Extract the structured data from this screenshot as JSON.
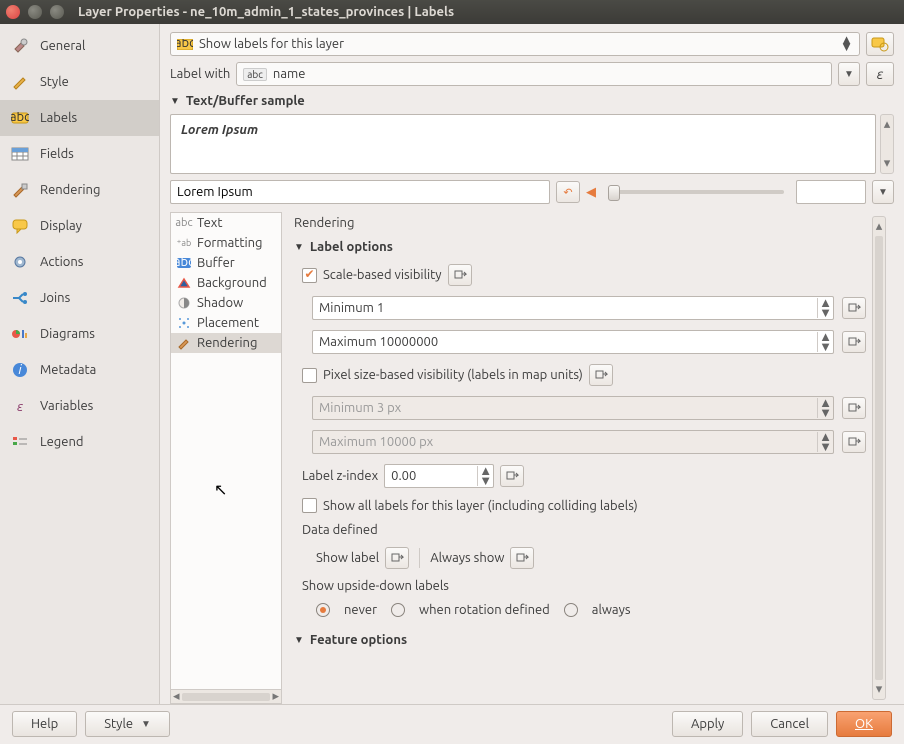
{
  "window": {
    "title": "Layer Properties - ne_10m_admin_1_states_provinces | Labels"
  },
  "sidebar": {
    "items": [
      {
        "label": "General"
      },
      {
        "label": "Style"
      },
      {
        "label": "Labels"
      },
      {
        "label": "Fields"
      },
      {
        "label": "Rendering"
      },
      {
        "label": "Display"
      },
      {
        "label": "Actions"
      },
      {
        "label": "Joins"
      },
      {
        "label": "Diagrams"
      },
      {
        "label": "Metadata"
      },
      {
        "label": "Variables"
      },
      {
        "label": "Legend"
      }
    ],
    "active_index": 2
  },
  "top": {
    "mode": "Show labels for this layer",
    "label_with_text": "Label with",
    "label_with_value": "name",
    "epsilon": "ε"
  },
  "sample": {
    "header": "Text/Buffer sample",
    "preview_text": "Lorem Ipsum",
    "input_value": "Lorem Ipsum"
  },
  "sublist": {
    "items": [
      {
        "label": "Text"
      },
      {
        "label": "Formatting"
      },
      {
        "label": "Buffer"
      },
      {
        "label": "Background"
      },
      {
        "label": "Shadow"
      },
      {
        "label": "Placement"
      },
      {
        "label": "Rendering"
      }
    ],
    "active_index": 6
  },
  "form": {
    "title": "Rendering",
    "label_options": {
      "header": "Label options",
      "scale_visibility": {
        "label": "Scale-based visibility",
        "checked": true
      },
      "minimum": "Minimum 1",
      "maximum": "Maximum 10000000",
      "pixel_visibility": {
        "label": "Pixel size-based visibility (labels in map units)",
        "checked": false
      },
      "pixel_min": "Minimum 3 px",
      "pixel_max": "Maximum 10000 px",
      "zindex_label": "Label z-index",
      "zindex_value": "0.00",
      "show_all": {
        "label": "Show all labels for this layer (including colliding labels)",
        "checked": false
      },
      "data_defined_header": "Data defined",
      "show_label": "Show label",
      "always_show": "Always show",
      "upside_header": "Show upside-down labels",
      "upside_options": [
        "never",
        "when rotation defined",
        "always"
      ],
      "upside_selected": 0
    },
    "feature_options": {
      "header": "Feature options"
    }
  },
  "footer": {
    "help": "Help",
    "style": "Style",
    "apply": "Apply",
    "cancel": "Cancel",
    "ok": "OK"
  }
}
